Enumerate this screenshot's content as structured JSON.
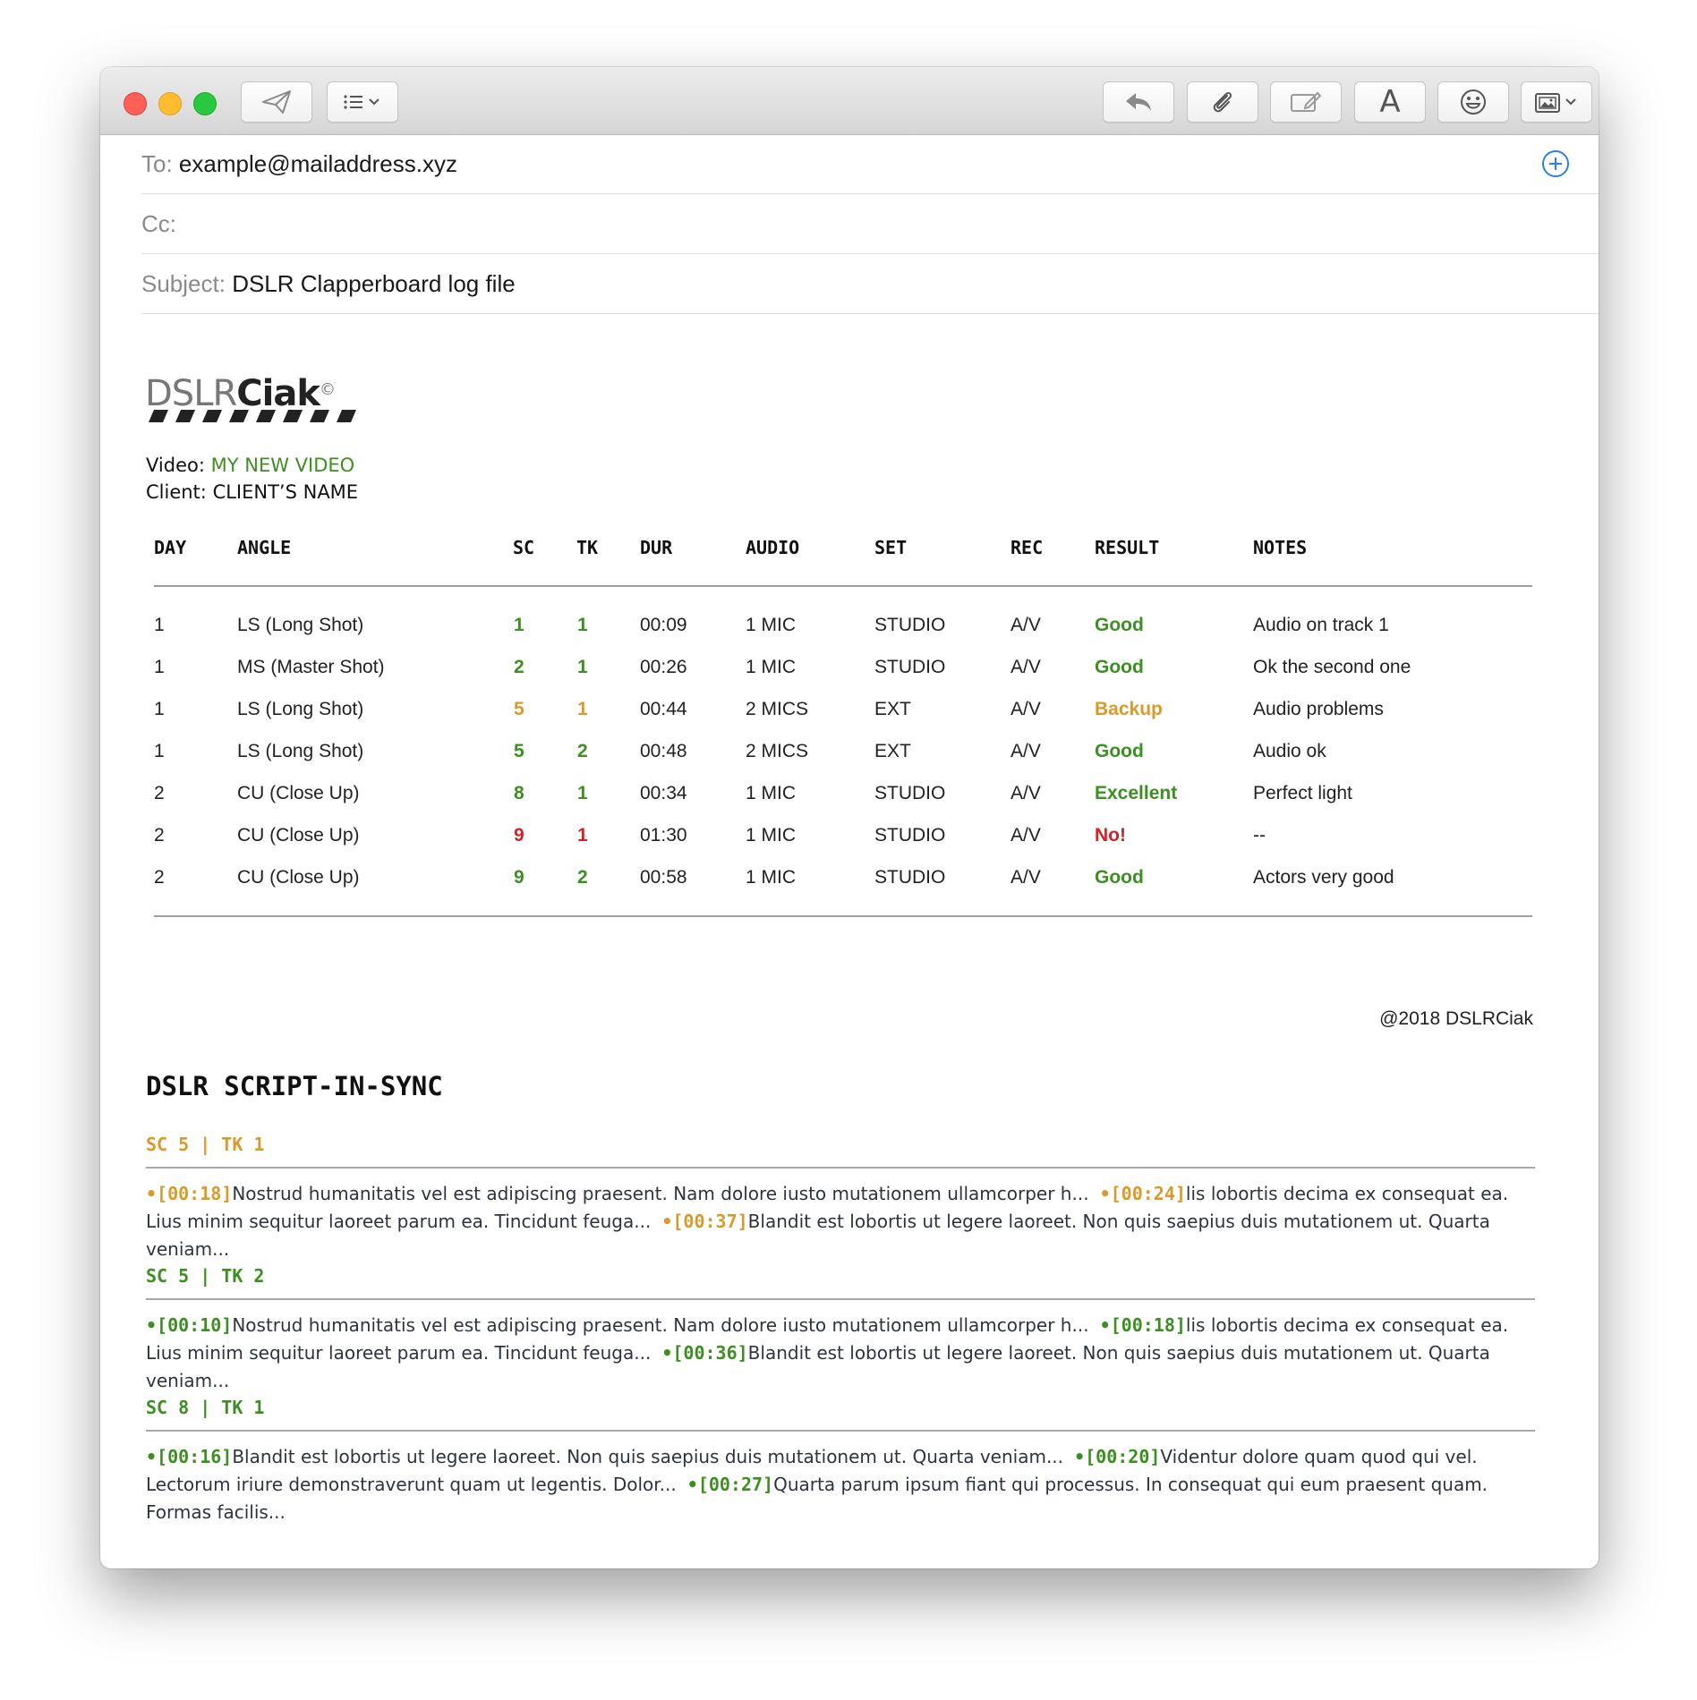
{
  "email": {
    "to_label": "To:",
    "to_value": "example@mailaddress.xyz",
    "cc_label": "Cc:",
    "cc_value": "",
    "subject_label": "Subject:",
    "subject_value": "DSLR Clapperboard log file"
  },
  "toolbar": {
    "format_label": "A"
  },
  "colors": {
    "good": "#3c8f20",
    "backup": "#d99a2a",
    "bad": "#cf2525",
    "accent_blue": "#2f7fe0"
  },
  "log": {
    "logo_main": "DSLR",
    "logo_bold": "Ciak",
    "logo_mark": "©",
    "video_label": "Video:",
    "video_value": "MY NEW VIDEO",
    "client_label": "Client:",
    "client_value": "CLIENT’S NAME",
    "headers": [
      "DAY",
      "ANGLE",
      "SC",
      "TK",
      "DUR",
      "AUDIO",
      "SET",
      "REC",
      "RESULT",
      "NOTES"
    ],
    "rows": [
      {
        "day": "1",
        "angle": "LS (Long Shot)",
        "sc": "1",
        "tk": "1",
        "dur": "00:09",
        "audio": "1 MIC",
        "set": "STUDIO",
        "rec": "A/V",
        "result": "Good",
        "notes": "Audio on track 1",
        "status": "good"
      },
      {
        "day": "1",
        "angle": "MS (Master Shot)",
        "sc": "2",
        "tk": "1",
        "dur": "00:26",
        "audio": "1 MIC",
        "set": "STUDIO",
        "rec": "A/V",
        "result": "Good",
        "notes": "Ok the second one",
        "status": "good"
      },
      {
        "day": "1",
        "angle": "LS (Long Shot)",
        "sc": "5",
        "tk": "1",
        "dur": "00:44",
        "audio": "2 MICS",
        "set": "EXT",
        "rec": "A/V",
        "result": "Backup",
        "notes": "Audio problems",
        "status": "backup"
      },
      {
        "day": "1",
        "angle": "LS (Long Shot)",
        "sc": "5",
        "tk": "2",
        "dur": "00:48",
        "audio": "2 MICS",
        "set": "EXT",
        "rec": "A/V",
        "result": "Good",
        "notes": "Audio ok",
        "status": "good"
      },
      {
        "day": "2",
        "angle": "CU (Close Up)",
        "sc": "8",
        "tk": "1",
        "dur": "00:34",
        "audio": "1 MIC",
        "set": "STUDIO",
        "rec": "A/V",
        "result": "Excellent",
        "notes": "Perfect light",
        "status": "good"
      },
      {
        "day": "2",
        "angle": "CU (Close Up)",
        "sc": "9",
        "tk": "1",
        "dur": "01:30",
        "audio": "1 MIC",
        "set": "STUDIO",
        "rec": "A/V",
        "result": "No!",
        "notes": "--",
        "status": "bad"
      },
      {
        "day": "2",
        "angle": "CU (Close Up)",
        "sc": "9",
        "tk": "2",
        "dur": "00:58",
        "audio": "1 MIC",
        "set": "STUDIO",
        "rec": "A/V",
        "result": "Good",
        "notes": "Actors very good",
        "status": "good"
      }
    ],
    "copyright": "@2018 DSLRCiak"
  },
  "sync": {
    "title": "DSLR SCRIPT-IN-SYNC",
    "sections": [
      {
        "heading": "SC 5 | TK 1",
        "status": "backup",
        "segments": [
          {
            "ts": "[00:18]",
            "text": "Nostrud humanitatis vel est adipiscing praesent. Nam dolore iusto mutationem ullamcorper h..."
          },
          {
            "ts": "[00:24]",
            "text": "lis lobortis decima ex consequat ea. Lius minim sequitur laoreet parum ea. Tincidunt feuga..."
          },
          {
            "ts": "[00:37]",
            "text": "Blandit est lobortis ut legere laoreet. Non quis saepius duis mutationem ut. Quarta veniam..."
          }
        ]
      },
      {
        "heading": "SC 5 | TK 2",
        "status": "good",
        "segments": [
          {
            "ts": "[00:10]",
            "text": "Nostrud humanitatis vel est adipiscing praesent. Nam dolore iusto mutationem ullamcorper h..."
          },
          {
            "ts": "[00:18]",
            "text": "lis lobortis decima ex consequat ea. Lius minim sequitur laoreet parum ea. Tincidunt feuga..."
          },
          {
            "ts": "[00:36]",
            "text": "Blandit est lobortis ut legere laoreet. Non quis saepius duis mutationem ut. Quarta veniam..."
          }
        ]
      },
      {
        "heading": "SC 8 | TK 1",
        "status": "good",
        "segments": [
          {
            "ts": "[00:16]",
            "text": "Blandit est lobortis ut legere laoreet. Non quis saepius duis mutationem ut. Quarta veniam..."
          },
          {
            "ts": "[00:20]",
            "text": "Videntur dolore quam quod qui vel. Lectorum iriure demonstraverunt quam ut legentis. Dolor..."
          },
          {
            "ts": "[00:27]",
            "text": "Quarta parum ipsum fiant qui processus. In consequat qui eum praesent quam. Formas facilis..."
          }
        ]
      }
    ]
  }
}
